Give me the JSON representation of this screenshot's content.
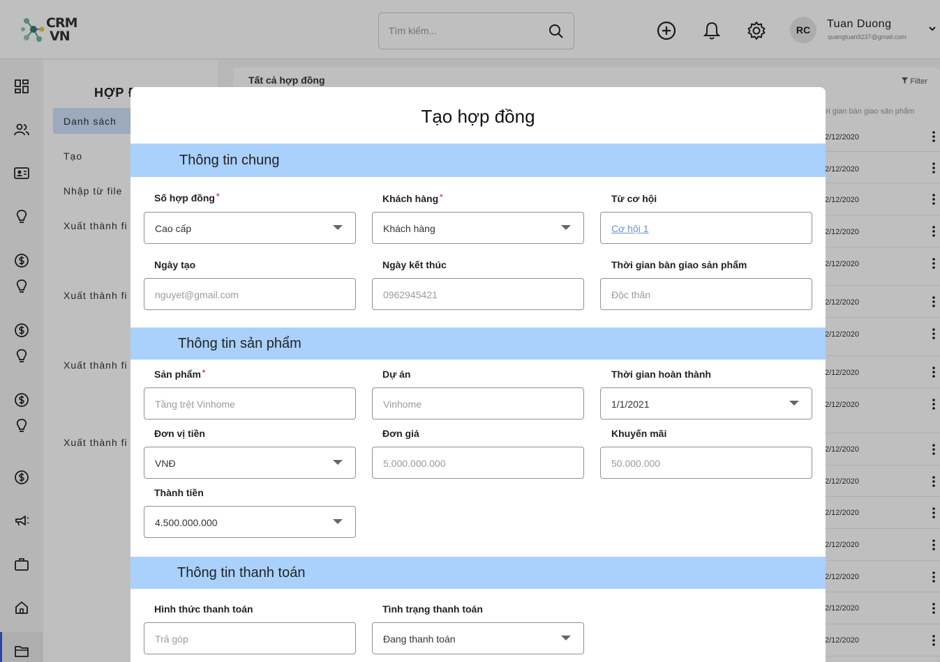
{
  "header": {
    "logo_line1": "CRM",
    "logo_line2": "VN",
    "search_placeholder": "Tìm kiếm...",
    "user_initials": "RC",
    "user_name": "Tuan Duong",
    "user_email": "quangtuan9237@gmail.com"
  },
  "submenu": {
    "title": "HỢP Đ",
    "items": [
      "Danh sách",
      "Tạo",
      "Nhập từ file",
      "Xuất thành fi",
      "Xuất thành fi",
      "Xuất thành fi",
      "Xuất thành fi"
    ]
  },
  "table": {
    "title": "Tất cả hợp đồng",
    "filter_label": "Filter",
    "column_header": "ời gian bàn giao sản phẩm",
    "row_dates": [
      "2/12/2020",
      "2/12/2020",
      "2/12/2020",
      "2/12/2020",
      "2/12/2020",
      "2/12/2020",
      "2/12/2020",
      "2/12/2020",
      "2/12/2020",
      "2/12/2020",
      "2/12/2020",
      "2/12/2020",
      "2/12/2020",
      "2/12/2020",
      "2/12/2020",
      "2/12/2020"
    ]
  },
  "modal": {
    "title": "Tạo hợp đồng",
    "sections": {
      "general": "Thông tin chung",
      "product": "Thông tin sản phẩm",
      "payment": "Thông tin thanh toán"
    },
    "fields": {
      "contract_no": {
        "label": "Số hợp đồng",
        "value": "Cao cấp"
      },
      "customer": {
        "label": "Khách hàng",
        "value": "Khách hàng"
      },
      "opportunity": {
        "label": "Từ cơ hội",
        "value": "Cơ hội 1"
      },
      "created_date": {
        "label": "Ngày tạo",
        "placeholder": "nguyet@gmail.com"
      },
      "end_date": {
        "label": "Ngày kết thúc",
        "placeholder": "0962945421"
      },
      "handover_time": {
        "label": "Thời gian bàn giao sản phẩm",
        "placeholder": "Độc thân"
      },
      "product": {
        "label": "Sản phẩm",
        "placeholder": "Tầng trệt Vinhome"
      },
      "project": {
        "label": "Dự án",
        "placeholder": "Vinhome"
      },
      "completion_time": {
        "label": "Thời gian hoàn thành",
        "value": "1/1/2021"
      },
      "currency": {
        "label": "Đơn vị tiền",
        "value": "VNĐ"
      },
      "unit_price": {
        "label": "Đơn giá",
        "placeholder": "5.000.000.000"
      },
      "promotion": {
        "label": "Khuyến mãi",
        "placeholder": "50.000.000"
      },
      "total": {
        "label": "Thành tiền",
        "value": "4.500.000.000"
      },
      "payment_method": {
        "label": "Hình thức thanh toán",
        "placeholder": "Trả góp"
      },
      "payment_status": {
        "label": "Tình trạng thanh toán",
        "value": "Đang thanh toán"
      }
    }
  },
  "colors": {
    "section_bg": "#a9d1fb",
    "active_menu_bg": "#cfe3fb",
    "required_mark": "#e53935",
    "link": "#6c8fd9"
  }
}
